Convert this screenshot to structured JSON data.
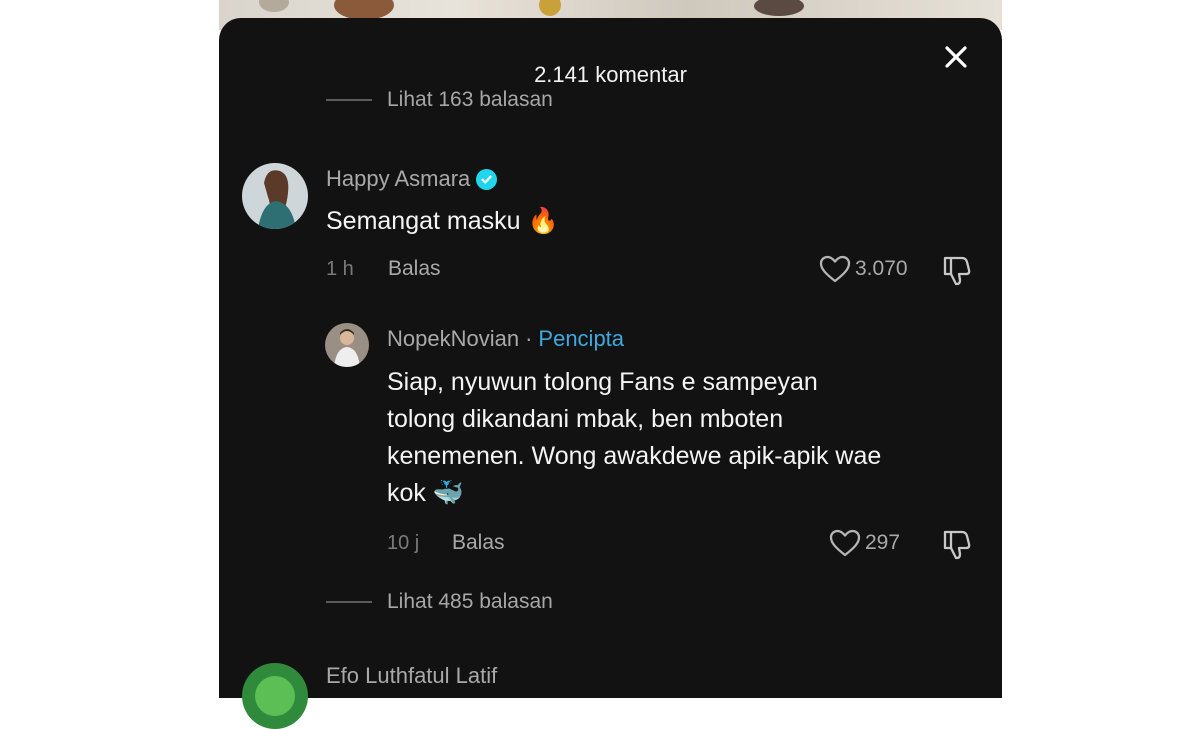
{
  "header": {
    "title": "2.141 komentar"
  },
  "thread": {
    "view_replies_top": "Lihat 163 balasan",
    "comment": {
      "username": "Happy Asmara",
      "text": "Semangat masku",
      "emoji": "🔥",
      "time": "1 h",
      "reply_label": "Balas",
      "likes": "3.070"
    },
    "reply": {
      "username": "NopekNovian",
      "separator": "·",
      "creator_label": "Pencipta",
      "text_lines": [
        "Siap, nyuwun tolong Fans e sampeyan",
        "tolong dikandani mbak, ben mboten",
        "kenemenen. Wong awakdewe apik-apik wae",
        "kok"
      ],
      "emoji": "🐳",
      "time": "10 j",
      "reply_label": "Balas",
      "likes": "297"
    },
    "view_replies_bottom": "Lihat 485 balasan",
    "next_comment_username": "Efo Luthfatul Latif"
  },
  "icons": {
    "close": "close-icon",
    "verified": "verified-badge-icon",
    "like": "heart-icon",
    "dislike": "thumbs-down-icon"
  },
  "colors": {
    "panel_bg": "#121212",
    "creator_accent": "#3fa9df",
    "verified_badge": "#20d5ec"
  }
}
